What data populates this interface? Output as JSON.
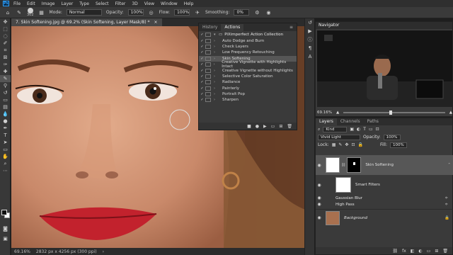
{
  "app": {
    "logo_text": "Ps"
  },
  "menu": [
    "File",
    "Edit",
    "Image",
    "Layer",
    "Type",
    "Select",
    "Filter",
    "3D",
    "View",
    "Window",
    "Help"
  ],
  "options": {
    "brush_size": "302",
    "mode_label": "Mode:",
    "mode_value": "Normal",
    "opacity_label": "Opacity:",
    "opacity_value": "100%",
    "flow_label": "Flow:",
    "flow_value": "100%",
    "smoothing_label": "Smoothing:",
    "smoothing_value": "0%"
  },
  "document": {
    "tab_title": "7. Skin Softening.jpg @ 69.2% (Skin Softening, Layer Mask/8) *",
    "zoom": "69.16%",
    "dimensions": "2832 px x 4256 px (300 ppi)"
  },
  "actions_panel": {
    "tabs": [
      "History",
      "Actions"
    ],
    "active_tab": "Actions",
    "set_name": "PiXimperfect Action Collection",
    "items": [
      "Auto Dodge and Burn",
      "Check Layers",
      "Low Frequency Retouching",
      "Skin Softening",
      "Creative Vignette with Highlights Intact",
      "Creative Vignette without Highlights",
      "Selective Color Saturation",
      "Radiance",
      "Painterly",
      "Portrait Pop",
      "Sharpen"
    ],
    "selected_item": "Skin Softening"
  },
  "navigator": {
    "title": "Navigator",
    "zoom": "69.16%",
    "zoom_fraction": 0.45
  },
  "layers_panel": {
    "tabs": [
      "Layers",
      "Channels",
      "Paths"
    ],
    "active_tab": "Layers",
    "filter_label": "Kind",
    "blend_mode": "Vivid Light",
    "opacity_label": "Opacity:",
    "opacity_value": "100%",
    "lock_label": "Lock:",
    "fill_label": "Fill:",
    "fill_value": "100%",
    "layers": [
      {
        "name": "Skin Softening",
        "kind": "smart-object-with-mask"
      },
      {
        "name": "Smart Filters",
        "kind": "smart-filters"
      },
      {
        "name": "Gaussian Blur",
        "kind": "filter"
      },
      {
        "name": "High Pass",
        "kind": "filter"
      },
      {
        "name": "Background",
        "kind": "background",
        "locked": true
      }
    ]
  },
  "colors": {
    "accent": "#2fa3ff",
    "panel_bg": "#3a3a3a",
    "selected_row": "#565656"
  }
}
